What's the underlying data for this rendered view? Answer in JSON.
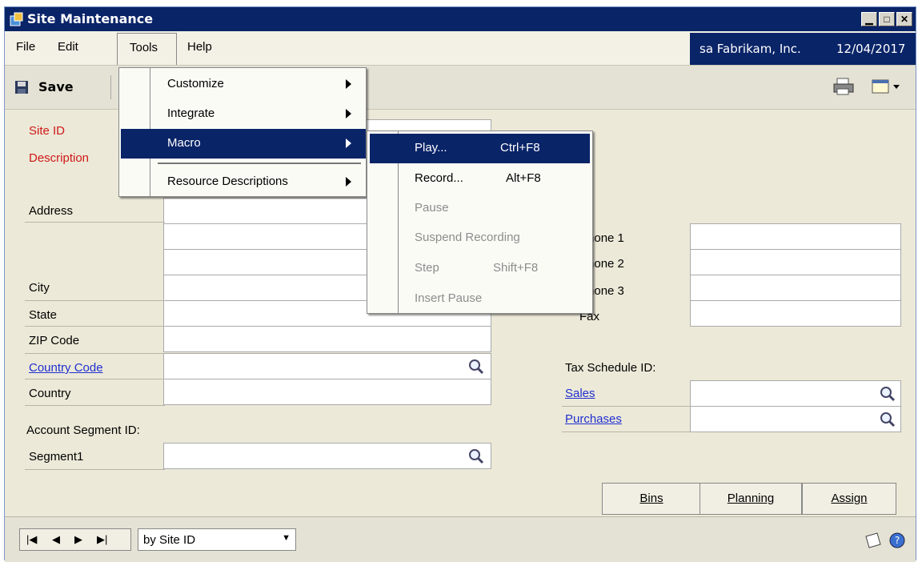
{
  "window": {
    "title": "Site Maintenance"
  },
  "menubar": {
    "items": [
      "File",
      "Edit",
      "Tools",
      "Help"
    ],
    "company": "sa  Fabrikam, Inc.",
    "date": "12/04/2017"
  },
  "toolbar": {
    "save_label": "Save"
  },
  "form": {
    "site_id_label": "Site ID",
    "description_label": "Description",
    "address_label": "Address",
    "city_label": "City",
    "state_label": "State",
    "zip_label": "ZIP Code",
    "country_code_label": "Country Code",
    "country_label": "Country",
    "account_segment_label": "Account Segment ID:",
    "segment1_label": "Segment1",
    "phone1_label": "Phone 1",
    "phone2_label": "Phone 2",
    "phone3_label": "Phone 3",
    "fax_label": "Fax",
    "tax_schedule_label": "Tax Schedule ID:",
    "sales_label": "Sales",
    "purchases_label": "Purchases"
  },
  "buttons": {
    "bins": "Bins",
    "planning": "Planning",
    "assign": "Assign"
  },
  "statusbar": {
    "sort_value": "by Site ID"
  },
  "tools_menu": {
    "items": [
      "Customize",
      "Integrate",
      "Macro",
      "Resource Descriptions"
    ],
    "selected": "Macro"
  },
  "macro_menu": {
    "items": [
      {
        "label": "Play...",
        "shortcut": "Ctrl+F8",
        "enabled": true,
        "selected": true
      },
      {
        "label": "Record...",
        "shortcut": "Alt+F8",
        "enabled": true
      },
      {
        "label": "Pause",
        "shortcut": "",
        "enabled": false
      },
      {
        "label": "Suspend Recording",
        "shortcut": "",
        "enabled": false
      },
      {
        "label": "Step",
        "shortcut": "Shift+F8",
        "enabled": false
      },
      {
        "label": "Insert Pause",
        "shortcut": "",
        "enabled": false
      }
    ]
  },
  "colors": {
    "titlebar": "#0a2468",
    "required_label": "#d01818",
    "link": "#1f2fd0",
    "selection": "#0a2468"
  }
}
